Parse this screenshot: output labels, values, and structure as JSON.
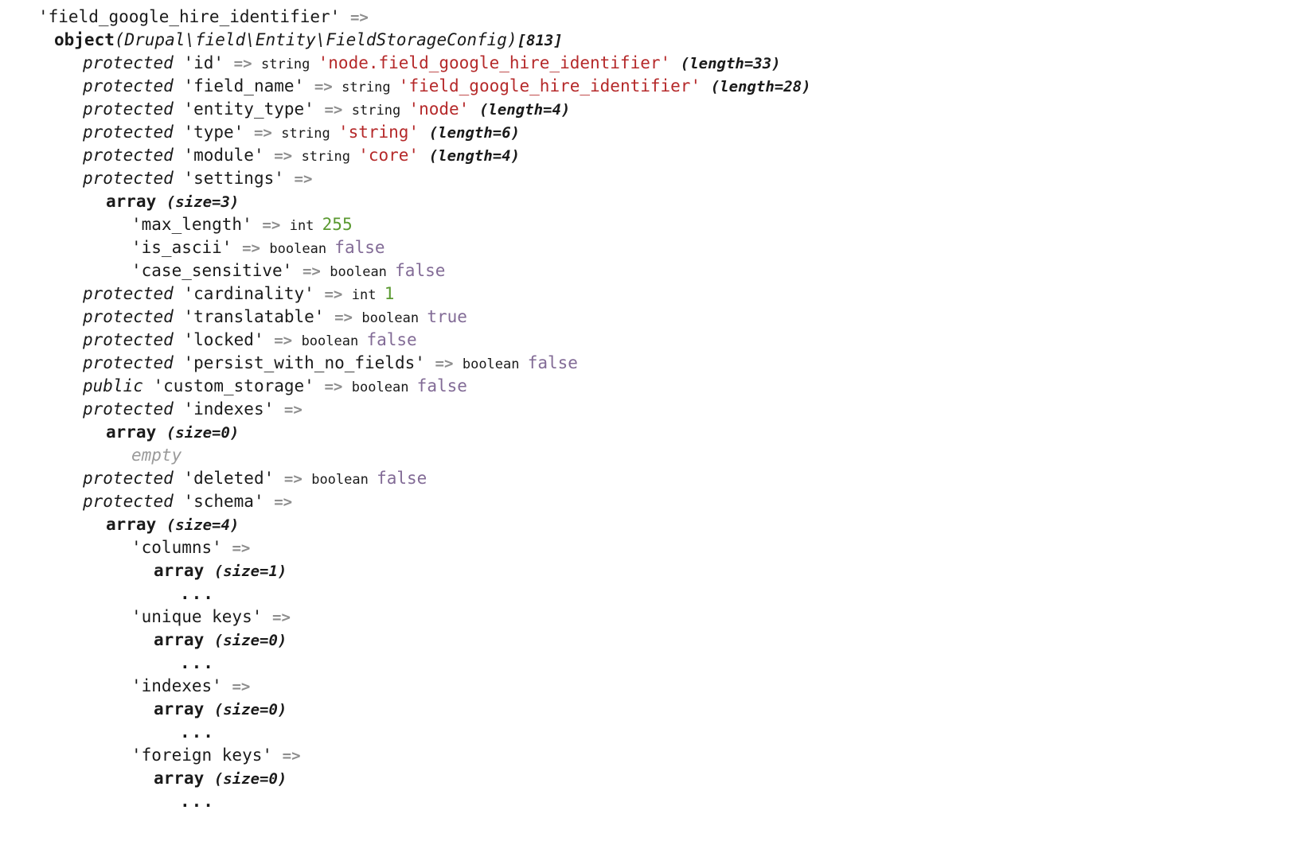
{
  "dump": {
    "title": "var_dump output",
    "colors": {
      "string": "#b5292a",
      "int": "#5a9930",
      "bool": "#826b96",
      "arrow": "#8d8d8d",
      "empty": "#9a9a9a",
      "text": "#1a1a1a",
      "background": "#ffffff"
    },
    "tokens": {
      "arrow": "=>",
      "ellipsis": "...",
      "type_string": "string",
      "type_boolean": "boolean",
      "type_int": "int",
      "kw_object": "object",
      "kw_array": "array",
      "vis_protected": "protected",
      "vis_public": "public",
      "empty": "empty"
    },
    "lines": [
      {
        "indent": 1,
        "name": "root-key",
        "parts": [
          {
            "cls": "key",
            "text": "'field_google_hire_identifier' "
          },
          {
            "cls": "arrow",
            "text": "=>"
          }
        ]
      },
      {
        "indent": 2,
        "name": "object-header",
        "parts": [
          {
            "cls": "kw",
            "text": "object"
          },
          {
            "cls": "cls",
            "text": "(Drupal\\field\\Entity\\FieldStorageConfig)"
          },
          {
            "cls": "meta",
            "text": "[813]"
          }
        ]
      },
      {
        "indent": 3,
        "name": "property-id",
        "parts": [
          {
            "cls": "vis",
            "text": "protected "
          },
          {
            "cls": "key",
            "text": "'id' "
          },
          {
            "cls": "arrow",
            "text": "=> "
          },
          {
            "cls": "type",
            "text": "string "
          },
          {
            "cls": "str",
            "text": "'node.field_google_hire_identifier' "
          },
          {
            "cls": "meta",
            "text": "(length=33)"
          }
        ]
      },
      {
        "indent": 3,
        "name": "property-field-name",
        "parts": [
          {
            "cls": "vis",
            "text": "protected "
          },
          {
            "cls": "key",
            "text": "'field_name' "
          },
          {
            "cls": "arrow",
            "text": "=> "
          },
          {
            "cls": "type",
            "text": "string "
          },
          {
            "cls": "str",
            "text": "'field_google_hire_identifier' "
          },
          {
            "cls": "meta",
            "text": "(length=28)"
          }
        ]
      },
      {
        "indent": 3,
        "name": "property-entity-type",
        "parts": [
          {
            "cls": "vis",
            "text": "protected "
          },
          {
            "cls": "key",
            "text": "'entity_type' "
          },
          {
            "cls": "arrow",
            "text": "=> "
          },
          {
            "cls": "type",
            "text": "string "
          },
          {
            "cls": "str",
            "text": "'node' "
          },
          {
            "cls": "meta",
            "text": "(length=4)"
          }
        ]
      },
      {
        "indent": 3,
        "name": "property-type",
        "parts": [
          {
            "cls": "vis",
            "text": "protected "
          },
          {
            "cls": "key",
            "text": "'type' "
          },
          {
            "cls": "arrow",
            "text": "=> "
          },
          {
            "cls": "type",
            "text": "string "
          },
          {
            "cls": "str",
            "text": "'string' "
          },
          {
            "cls": "meta",
            "text": "(length=6)"
          }
        ]
      },
      {
        "indent": 3,
        "name": "property-module",
        "parts": [
          {
            "cls": "vis",
            "text": "protected "
          },
          {
            "cls": "key",
            "text": "'module' "
          },
          {
            "cls": "arrow",
            "text": "=> "
          },
          {
            "cls": "type",
            "text": "string "
          },
          {
            "cls": "str",
            "text": "'core' "
          },
          {
            "cls": "meta",
            "text": "(length=4)"
          }
        ]
      },
      {
        "indent": 3,
        "name": "property-settings",
        "parts": [
          {
            "cls": "vis",
            "text": "protected "
          },
          {
            "cls": "key",
            "text": "'settings' "
          },
          {
            "cls": "arrow",
            "text": "=>"
          }
        ]
      },
      {
        "indent": 4,
        "name": "settings-array-header",
        "parts": [
          {
            "cls": "kw",
            "text": "array "
          },
          {
            "cls": "meta",
            "text": "(size=3)"
          }
        ]
      },
      {
        "indent": 5,
        "name": "settings-max-length",
        "parts": [
          {
            "cls": "key",
            "text": "'max_length' "
          },
          {
            "cls": "arrow",
            "text": "=> "
          },
          {
            "cls": "type",
            "text": "int "
          },
          {
            "cls": "num",
            "text": "255"
          }
        ]
      },
      {
        "indent": 5,
        "name": "settings-is-ascii",
        "parts": [
          {
            "cls": "key",
            "text": "'is_ascii' "
          },
          {
            "cls": "arrow",
            "text": "=> "
          },
          {
            "cls": "type",
            "text": "boolean "
          },
          {
            "cls": "bool",
            "text": "false"
          }
        ]
      },
      {
        "indent": 5,
        "name": "settings-case-sensitive",
        "parts": [
          {
            "cls": "key",
            "text": "'case_sensitive' "
          },
          {
            "cls": "arrow",
            "text": "=> "
          },
          {
            "cls": "type",
            "text": "boolean "
          },
          {
            "cls": "bool",
            "text": "false"
          }
        ]
      },
      {
        "indent": 3,
        "name": "property-cardinality",
        "parts": [
          {
            "cls": "vis",
            "text": "protected "
          },
          {
            "cls": "key",
            "text": "'cardinality' "
          },
          {
            "cls": "arrow",
            "text": "=> "
          },
          {
            "cls": "type",
            "text": "int "
          },
          {
            "cls": "num",
            "text": "1"
          }
        ]
      },
      {
        "indent": 3,
        "name": "property-translatable",
        "parts": [
          {
            "cls": "vis",
            "text": "protected "
          },
          {
            "cls": "key",
            "text": "'translatable' "
          },
          {
            "cls": "arrow",
            "text": "=> "
          },
          {
            "cls": "type",
            "text": "boolean "
          },
          {
            "cls": "bool",
            "text": "true"
          }
        ]
      },
      {
        "indent": 3,
        "name": "property-locked",
        "parts": [
          {
            "cls": "vis",
            "text": "protected "
          },
          {
            "cls": "key",
            "text": "'locked' "
          },
          {
            "cls": "arrow",
            "text": "=> "
          },
          {
            "cls": "type",
            "text": "boolean "
          },
          {
            "cls": "bool",
            "text": "false"
          }
        ]
      },
      {
        "indent": 3,
        "name": "property-persist-with-no-fields",
        "parts": [
          {
            "cls": "vis",
            "text": "protected "
          },
          {
            "cls": "key",
            "text": "'persist_with_no_fields' "
          },
          {
            "cls": "arrow",
            "text": "=> "
          },
          {
            "cls": "type",
            "text": "boolean "
          },
          {
            "cls": "bool",
            "text": "false"
          }
        ]
      },
      {
        "indent": 3,
        "name": "property-custom-storage",
        "parts": [
          {
            "cls": "vis",
            "text": "public "
          },
          {
            "cls": "key",
            "text": "'custom_storage' "
          },
          {
            "cls": "arrow",
            "text": "=> "
          },
          {
            "cls": "type",
            "text": "boolean "
          },
          {
            "cls": "bool",
            "text": "false"
          }
        ]
      },
      {
        "indent": 3,
        "name": "property-indexes",
        "parts": [
          {
            "cls": "vis",
            "text": "protected "
          },
          {
            "cls": "key",
            "text": "'indexes' "
          },
          {
            "cls": "arrow",
            "text": "=>"
          }
        ]
      },
      {
        "indent": 4,
        "name": "indexes-array-header",
        "parts": [
          {
            "cls": "kw",
            "text": "array "
          },
          {
            "cls": "meta",
            "text": "(size=0)"
          }
        ]
      },
      {
        "indent": 5,
        "name": "indexes-empty",
        "parts": [
          {
            "cls": "empty",
            "text": "empty"
          }
        ]
      },
      {
        "indent": 3,
        "name": "property-deleted",
        "parts": [
          {
            "cls": "vis",
            "text": "protected "
          },
          {
            "cls": "key",
            "text": "'deleted' "
          },
          {
            "cls": "arrow",
            "text": "=> "
          },
          {
            "cls": "type",
            "text": "boolean "
          },
          {
            "cls": "bool",
            "text": "false"
          }
        ]
      },
      {
        "indent": 3,
        "name": "property-schema",
        "parts": [
          {
            "cls": "vis",
            "text": "protected "
          },
          {
            "cls": "key",
            "text": "'schema' "
          },
          {
            "cls": "arrow",
            "text": "=>"
          }
        ]
      },
      {
        "indent": 4,
        "name": "schema-array-header",
        "parts": [
          {
            "cls": "kw",
            "text": "array "
          },
          {
            "cls": "meta",
            "text": "(size=4)"
          }
        ]
      },
      {
        "indent": 5,
        "name": "schema-columns",
        "parts": [
          {
            "cls": "key",
            "text": "'columns' "
          },
          {
            "cls": "arrow",
            "text": "=>"
          }
        ]
      },
      {
        "indent": 6,
        "name": "schema-columns-array-header",
        "parts": [
          {
            "cls": "kw",
            "text": "array "
          },
          {
            "cls": "meta",
            "text": "(size=1)"
          }
        ]
      },
      {
        "indent": 7,
        "name": "schema-columns-ellipsis",
        "parts": [
          {
            "cls": "dots",
            "text": "..."
          }
        ]
      },
      {
        "indent": 5,
        "name": "schema-unique-keys",
        "parts": [
          {
            "cls": "key",
            "text": "'unique keys' "
          },
          {
            "cls": "arrow",
            "text": "=>"
          }
        ]
      },
      {
        "indent": 6,
        "name": "schema-unique-keys-array-header",
        "parts": [
          {
            "cls": "kw",
            "text": "array "
          },
          {
            "cls": "meta",
            "text": "(size=0)"
          }
        ]
      },
      {
        "indent": 7,
        "name": "schema-unique-keys-ellipsis",
        "parts": [
          {
            "cls": "dots",
            "text": "..."
          }
        ]
      },
      {
        "indent": 5,
        "name": "schema-indexes",
        "parts": [
          {
            "cls": "key",
            "text": "'indexes' "
          },
          {
            "cls": "arrow",
            "text": "=>"
          }
        ]
      },
      {
        "indent": 6,
        "name": "schema-indexes-array-header",
        "parts": [
          {
            "cls": "kw",
            "text": "array "
          },
          {
            "cls": "meta",
            "text": "(size=0)"
          }
        ]
      },
      {
        "indent": 7,
        "name": "schema-indexes-ellipsis",
        "parts": [
          {
            "cls": "dots",
            "text": "..."
          }
        ]
      },
      {
        "indent": 5,
        "name": "schema-foreign-keys",
        "parts": [
          {
            "cls": "key",
            "text": "'foreign keys' "
          },
          {
            "cls": "arrow",
            "text": "=>"
          }
        ]
      },
      {
        "indent": 6,
        "name": "schema-foreign-keys-array-header",
        "parts": [
          {
            "cls": "kw",
            "text": "array "
          },
          {
            "cls": "meta",
            "text": "(size=0)"
          }
        ]
      },
      {
        "indent": 7,
        "name": "schema-foreign-keys-ellipsis",
        "parts": [
          {
            "cls": "dots",
            "text": "..."
          }
        ]
      }
    ]
  }
}
